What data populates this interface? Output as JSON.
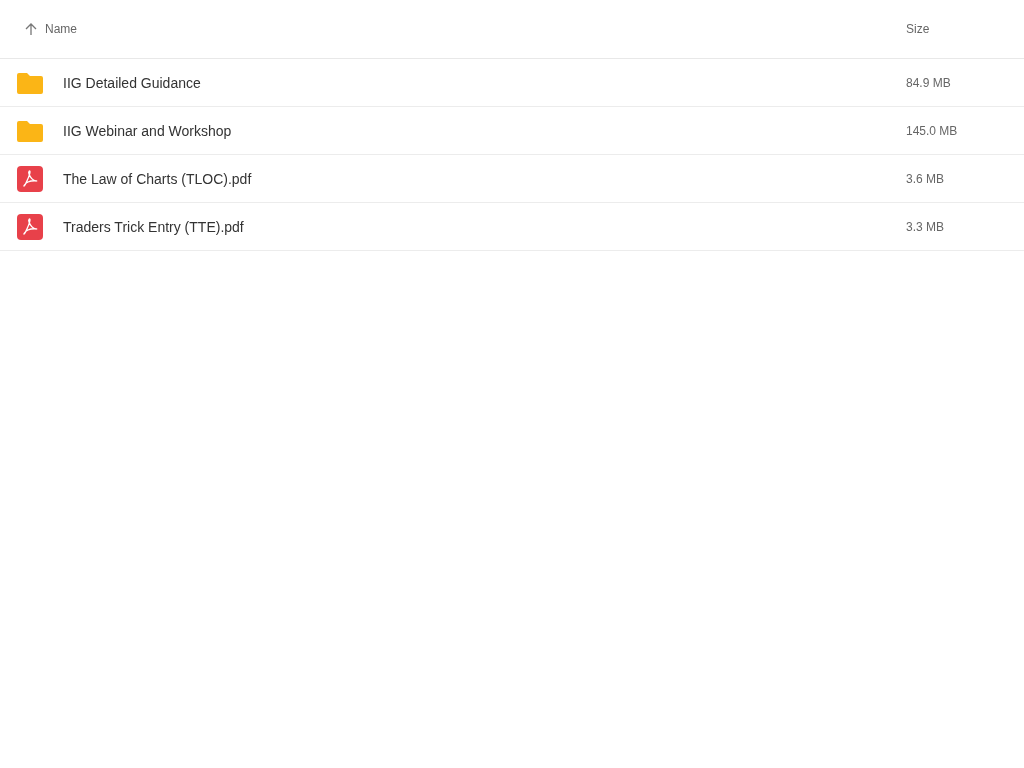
{
  "table": {
    "columns": [
      {
        "label": "Name",
        "sorted": true
      },
      {
        "label": "Size",
        "sorted": false
      }
    ],
    "rows": [
      {
        "kind": "folder",
        "name": "IIG Detailed Guidance",
        "size": "84.9 MB"
      },
      {
        "kind": "folder",
        "name": "IIG Webinar and Workshop",
        "size": "145.0 MB"
      },
      {
        "kind": "pdf",
        "name": "The Law of Charts (TLOC).pdf",
        "size": "3.6 MB"
      },
      {
        "kind": "pdf",
        "name": "Traders Trick Entry (TTE).pdf",
        "size": "3.3 MB"
      }
    ]
  }
}
